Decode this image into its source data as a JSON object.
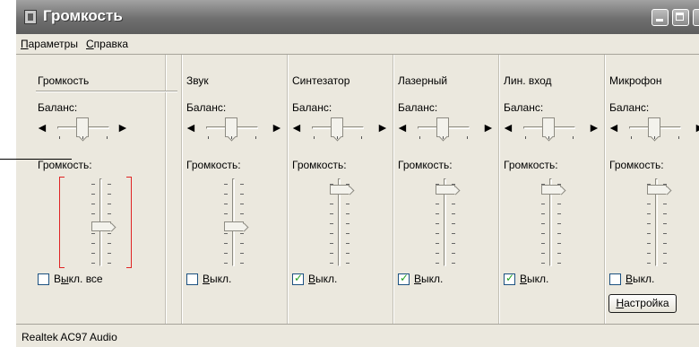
{
  "window": {
    "title": "Громкость"
  },
  "menu": [
    {
      "hotkey": "П",
      "rest": "араметры"
    },
    {
      "hotkey": "С",
      "rest": "правка"
    }
  ],
  "common": {
    "balance_label": "Баланс:",
    "volume_label": "Громкость:",
    "speaker_left": "◄",
    "speaker_right": "►"
  },
  "channels": [
    {
      "name": "Громкость",
      "volume_level": 0.45,
      "balance": 0.5,
      "mute_hotkey": "ы",
      "mute_pre": "В",
      "mute_post": "кл. все",
      "muted": false
    },
    {
      "name": "Звук",
      "volume_level": 0.45,
      "balance": 0.5,
      "mute_hotkey": "В",
      "mute_pre": "",
      "mute_post": "ыкл.",
      "muted": false
    },
    {
      "name": "Синтезатор",
      "volume_level": 0.92,
      "balance": 0.5,
      "mute_hotkey": "В",
      "mute_pre": "",
      "mute_post": "ыкл.",
      "muted": true
    },
    {
      "name": "Лазерный",
      "volume_level": 0.92,
      "balance": 0.5,
      "mute_hotkey": "В",
      "mute_pre": "",
      "mute_post": "ыкл.",
      "muted": true
    },
    {
      "name": "Лин. вход",
      "volume_level": 0.92,
      "balance": 0.5,
      "mute_hotkey": "В",
      "mute_pre": "",
      "mute_post": "ыкл.",
      "muted": true
    },
    {
      "name": "Микрофон",
      "volume_level": 0.92,
      "balance": 0.5,
      "mute_hotkey": "В",
      "mute_pre": "",
      "mute_post": "ыкл.",
      "muted": false
    }
  ],
  "setup_button": {
    "hotkey": "Н",
    "rest": "астройка"
  },
  "status": {
    "device": "Realtek AC97 Audio"
  },
  "colors": {
    "highlight_bracket": "#e02424",
    "check_mark": "#21a121"
  }
}
